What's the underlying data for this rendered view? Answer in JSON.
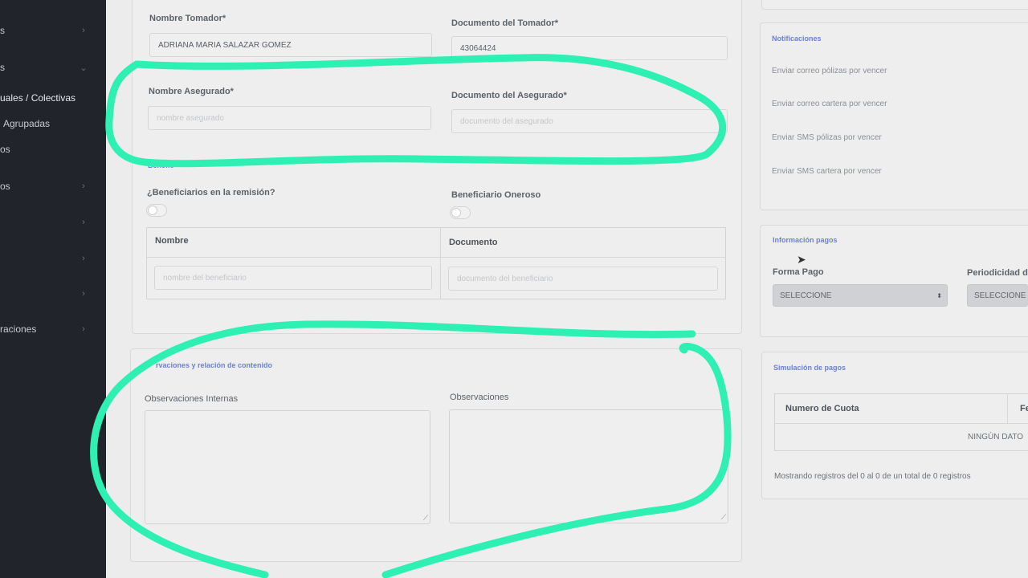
{
  "sidebar": {
    "items": [
      {
        "label": "s",
        "chevron": "›"
      },
      {
        "label": "s",
        "chevron": "⌄"
      },
      {
        "label": "uales / Colectivas",
        "chevron": ""
      },
      {
        "label": "Agrupadas",
        "chevron": ""
      },
      {
        "label": "os",
        "chevron": ""
      },
      {
        "label": "os",
        "chevron": "›"
      },
      {
        "label": "",
        "chevron": "›"
      },
      {
        "label": "",
        "chevron": "›"
      },
      {
        "label": "",
        "chevron": "›"
      },
      {
        "label": "raciones",
        "chevron": "›"
      }
    ]
  },
  "form": {
    "tomador": {
      "name_label": "Nombre Tomador*",
      "name_value": "ADRIANA MARIA SALAZAR GOMEZ",
      "doc_label": "Documento del Tomador*",
      "doc_value": "43064424"
    },
    "asegurado": {
      "name_label": "Nombre Asegurado*",
      "name_placeholder": "nombre asegurado",
      "doc_label": "Documento del Asegurado*",
      "doc_placeholder": "documento del asegurado"
    },
    "beneficiarios": {
      "section_title": "Benefic",
      "in_remission_label": "¿Beneficiarios en la remisión?",
      "oneroso_label": "Beneficiario Oneroso",
      "table": {
        "headers": [
          "Nombre",
          "Documento"
        ],
        "name_placeholder": "nombre del beneficiario",
        "doc_placeholder": "documento del beneficiario"
      }
    },
    "observaciones": {
      "section_title": "rvaciones y relación de contenido",
      "internal_label": "Observaciones Internas",
      "label": "Observaciones"
    }
  },
  "notificaciones": {
    "title": "Notificaciones",
    "items": [
      "Enviar correo pólizas por vencer",
      "Enviar correo cartera por vencer",
      "Enviar SMS pólizas por vencer",
      "Enviar SMS cartera por vencer"
    ]
  },
  "pagos": {
    "title": "Información pagos",
    "forma_label": "Forma Pago",
    "forma_value": "SELECCIONE",
    "periodicidad_label": "Periodicidad de",
    "periodicidad_value": "SELECCIONE"
  },
  "simulacion": {
    "title": "Simulación de pagos",
    "headers": [
      "Numero de Cuota",
      "Fe"
    ],
    "empty": "NINGÚN DATO",
    "footer": "Mostrando registros del 0 al 0 de un total de 0 registros"
  },
  "colors": {
    "annotation": "#2ef0b2",
    "sidebar": "#22242b",
    "section_title": "#6c80d6"
  }
}
